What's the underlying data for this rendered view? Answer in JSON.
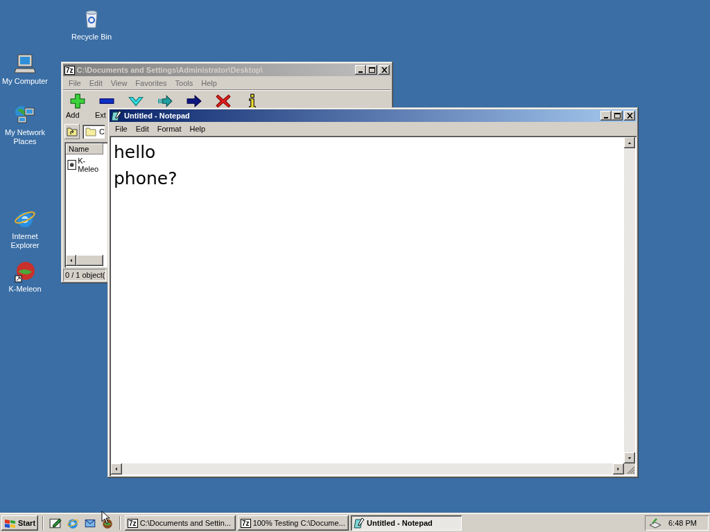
{
  "desktop_icons": [
    {
      "kind": "recycle",
      "label": "Recycle Bin"
    },
    {
      "kind": "computer",
      "label": "My Computer"
    },
    {
      "kind": "network",
      "label": "My Network Places"
    },
    {
      "kind": "ie",
      "label": "Internet Explorer"
    },
    {
      "kind": "kmeleon",
      "label": "K-Meleon"
    }
  ],
  "archive_window": {
    "logo": "7z",
    "title": "C:\\Documents and Settings\\Administrator\\Desktop\\",
    "active": false,
    "menu": [
      "File",
      "Edit",
      "View",
      "Favorites",
      "Tools",
      "Help"
    ],
    "toolbar": [
      {
        "kind": "add",
        "label": "Add"
      },
      {
        "kind": "extract",
        "label": "Ext"
      },
      {
        "kind": "test"
      },
      {
        "kind": "copy"
      },
      {
        "kind": "move"
      },
      {
        "kind": "delete"
      },
      {
        "kind": "info"
      }
    ],
    "address": "C",
    "columns": [
      "Name"
    ],
    "rows": [
      "K-Meleo"
    ],
    "status": "0 / 1 object("
  },
  "notepad": {
    "title": "Untitled - Notepad",
    "active": true,
    "menu": [
      "File",
      "Edit",
      "Format",
      "Help"
    ],
    "lines": [
      "hello",
      "phone?"
    ]
  },
  "taskbar": {
    "start": "Start",
    "quick_launch": [
      {
        "kind": "desktop"
      },
      {
        "kind": "ie"
      },
      {
        "kind": "outlook"
      },
      {
        "kind": "kmeleon"
      }
    ],
    "tasks": [
      {
        "kind": "archive",
        "logo": "7z",
        "label": "C:\\Documents and Settin...",
        "selected": false
      },
      {
        "kind": "archive",
        "logo": "7z",
        "label": "100% Testing C:\\Docume...",
        "selected": false
      },
      {
        "kind": "notepad",
        "label": "Untitled - Notepad",
        "selected": true
      }
    ],
    "clock": "6:48 PM"
  }
}
